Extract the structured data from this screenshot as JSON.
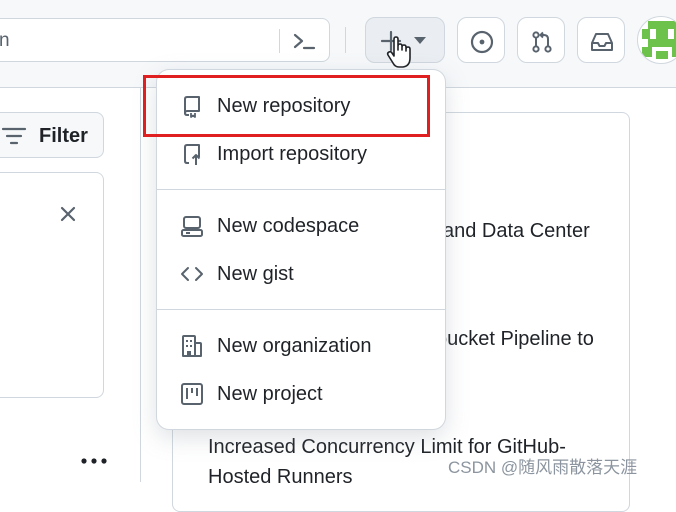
{
  "header": {
    "search_placeholder": "n",
    "create_button_label": "+"
  },
  "sidebar": {
    "filter_label": "Filter",
    "more_label": "..."
  },
  "create_menu": {
    "items": [
      {
        "label": "New repository",
        "icon": "repo-icon"
      },
      {
        "label": "Import repository",
        "icon": "repo-push-icon"
      },
      {
        "label": "New codespace",
        "icon": "codespaces-icon"
      },
      {
        "label": "New gist",
        "icon": "code-icon"
      },
      {
        "label": "New organization",
        "icon": "organization-icon"
      },
      {
        "label": "New project",
        "icon": "project-icon"
      }
    ],
    "highlight_color": "#e02020"
  },
  "feed": {
    "items": [
      "and Data Center",
      "oucket Pipeline to",
      "Increased Concurrency Limit for GitHub-",
      "Hosted Runners"
    ]
  },
  "watermark": "CSDN @随风雨散落天涯"
}
